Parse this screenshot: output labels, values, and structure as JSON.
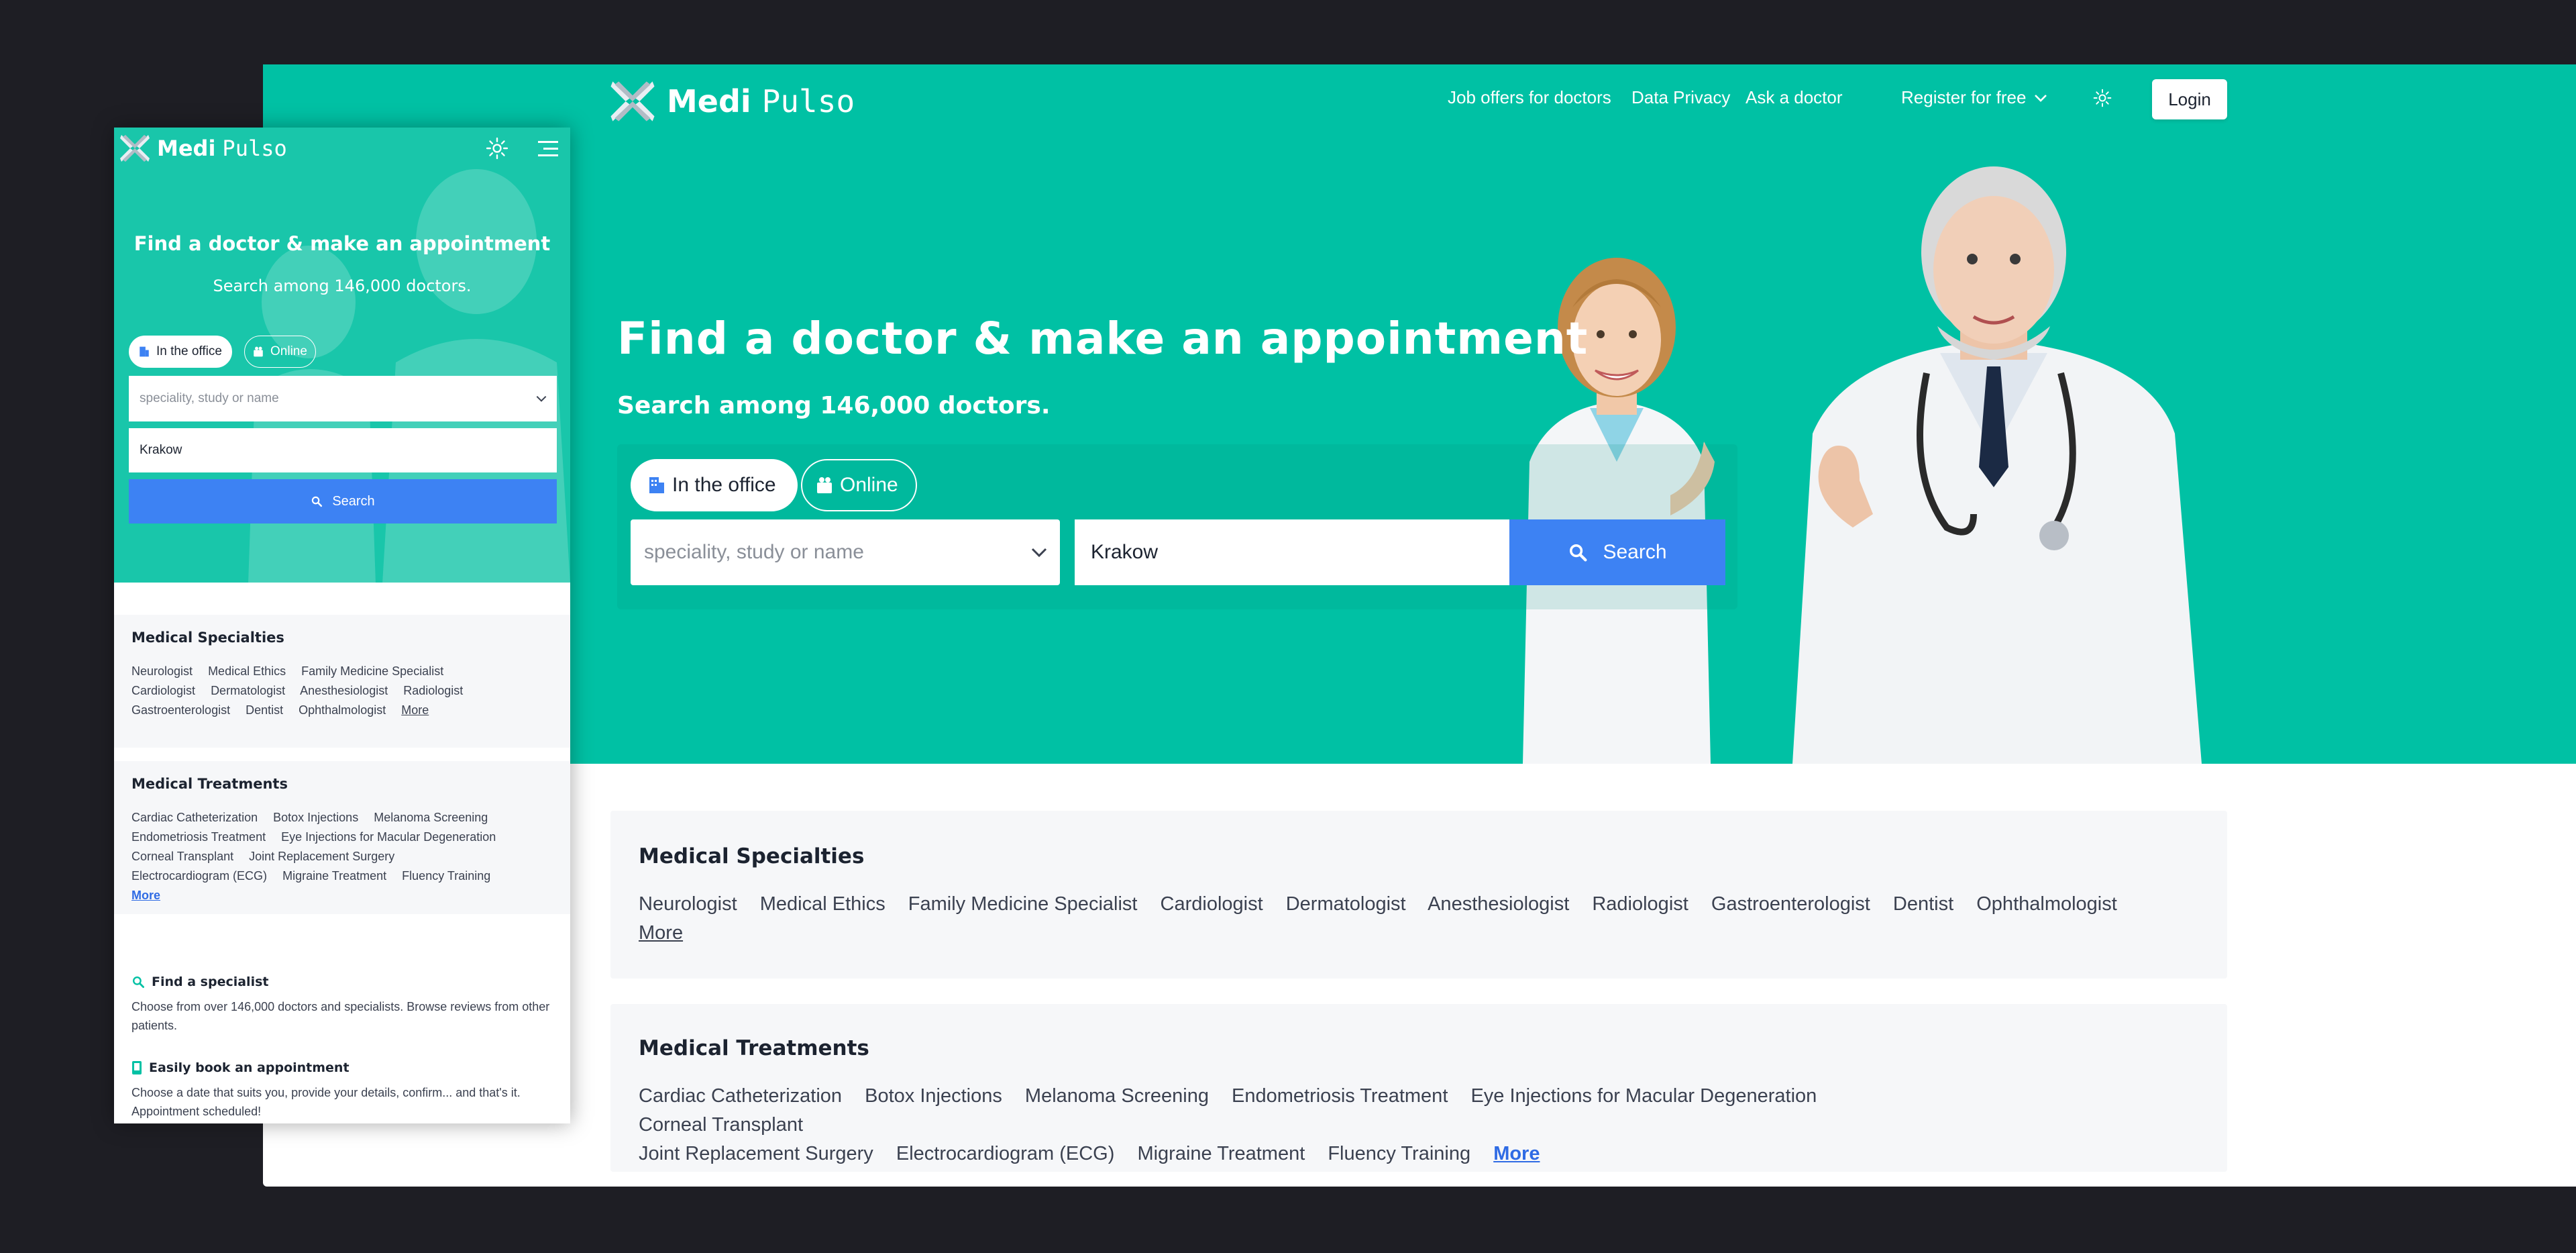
{
  "brand": {
    "name_bold": "Medi",
    "name_light": "Pulso",
    "accent": "#00c1a4",
    "button_blue": "#3d82f3"
  },
  "desktop": {
    "nav": {
      "job_offers": "Job offers for doctors",
      "privacy": "Data Privacy",
      "ask": "Ask a doctor",
      "register": "Register for free",
      "login": "Login",
      "theme_icon": "sun-icon"
    },
    "hero": {
      "title": "Find a doctor & make an appointment",
      "subtitle": "Search among 146,000 doctors."
    },
    "search": {
      "tab_office": "In the office",
      "tab_online": "Online",
      "specialty_placeholder": "speciality, study or name",
      "city_value": "Krakow",
      "button": "Search"
    },
    "specialties": {
      "title": "Medical Specialties",
      "items": [
        "Neurologist",
        "Medical Ethics",
        "Family Medicine Specialist",
        "Cardiologist",
        "Dermatologist",
        "Anesthesiologist",
        "Radiologist",
        "Gastroenterologist",
        "Dentist",
        "Ophthalmologist"
      ],
      "more": "More"
    },
    "treatments": {
      "title": "Medical Treatments",
      "items": [
        "Cardiac Catheterization",
        "Botox Injections",
        "Melanoma Screening",
        "Endometriosis Treatment",
        "Eye Injections for Macular Degeneration",
        "Corneal Transplant",
        "Joint Replacement Surgery",
        "Electrocardiogram (ECG)",
        "Migraine Treatment",
        "Fluency Training"
      ],
      "more": "More"
    }
  },
  "mobile": {
    "hero": {
      "title": "Find a doctor & make an appointment",
      "subtitle": "Search among 146,000 doctors."
    },
    "search": {
      "tab_office": "In the office",
      "tab_online": "Online",
      "specialty_placeholder": "speciality, study or name",
      "city_value": "Krakow",
      "button": "Search"
    },
    "specialties": {
      "title": "Medical Specialties",
      "items": [
        "Neurologist",
        "Medical Ethics",
        "Family Medicine Specialist",
        "Cardiologist",
        "Dermatologist",
        "Anesthesiologist",
        "Radiologist",
        "Gastroenterologist",
        "Dentist",
        "Ophthalmologist"
      ],
      "more": "More"
    },
    "treatments": {
      "title": "Medical Treatments",
      "items": [
        "Cardiac Catheterization",
        "Botox Injections",
        "Melanoma Screening",
        "Endometriosis Treatment",
        "Eye Injections for Macular Degeneration",
        "Corneal Transplant",
        "Joint Replacement Surgery",
        "Electrocardiogram (ECG)",
        "Migraine Treatment",
        "Fluency Training"
      ],
      "more": "More"
    },
    "features": [
      {
        "icon": "search-icon",
        "title": "Find a specialist",
        "text": "Choose from over 146,000 doctors and specialists. Browse reviews from other patients."
      },
      {
        "icon": "phone-icon",
        "title": "Easily book an appointment",
        "text": "Choose a date that suits you, provide your details, confirm... and that's it. Appointment scheduled!"
      }
    ]
  }
}
